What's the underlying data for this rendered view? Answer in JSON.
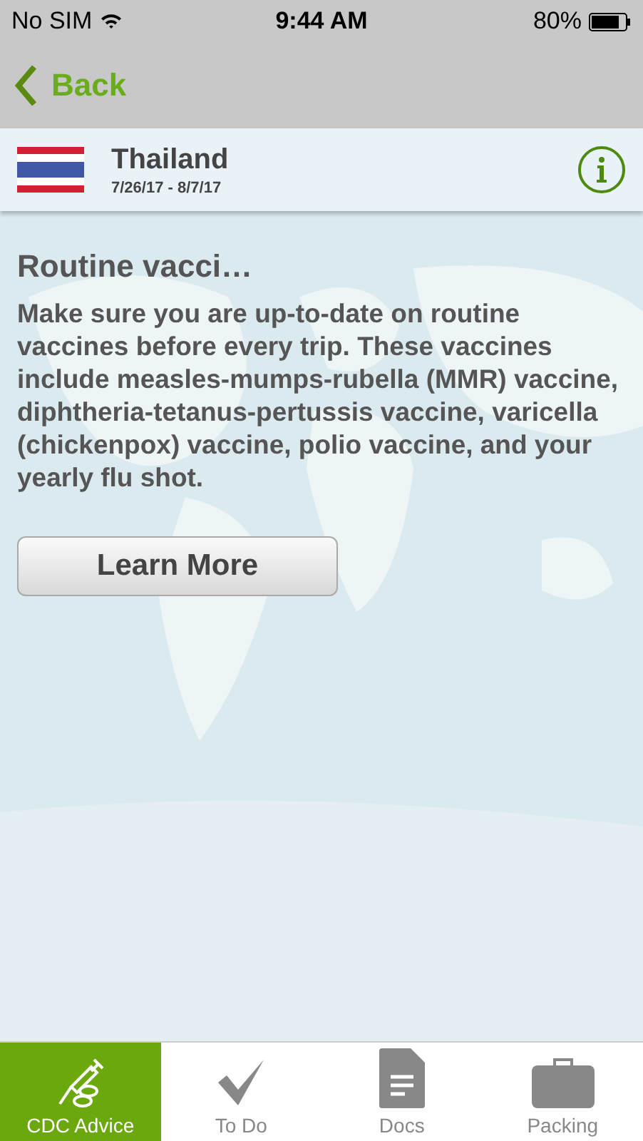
{
  "status_bar": {
    "carrier": "No SIM",
    "time": "9:44 AM",
    "battery": "80%"
  },
  "nav": {
    "back": "Back"
  },
  "trip": {
    "country": "Thailand",
    "dates": "7/26/17 - 8/7/17"
  },
  "advice": {
    "title": "Routine vacci…",
    "body": "Make sure you are up-to-date on routine vaccines before every trip. These vaccines include measles-mumps-rubella (MMR) vaccine, diphtheria-tetanus-pertussis vaccine, varicella (chickenpox) vaccine, polio vaccine, and your yearly flu shot.",
    "button": "Learn More"
  },
  "tabs": [
    {
      "label": "CDC Advice",
      "kind": "syringe",
      "selected": true
    },
    {
      "label": "To Do",
      "kind": "check",
      "selected": false
    },
    {
      "label": "Docs",
      "kind": "document",
      "selected": false
    },
    {
      "label": "Packing",
      "kind": "suitcase",
      "selected": false
    }
  ]
}
